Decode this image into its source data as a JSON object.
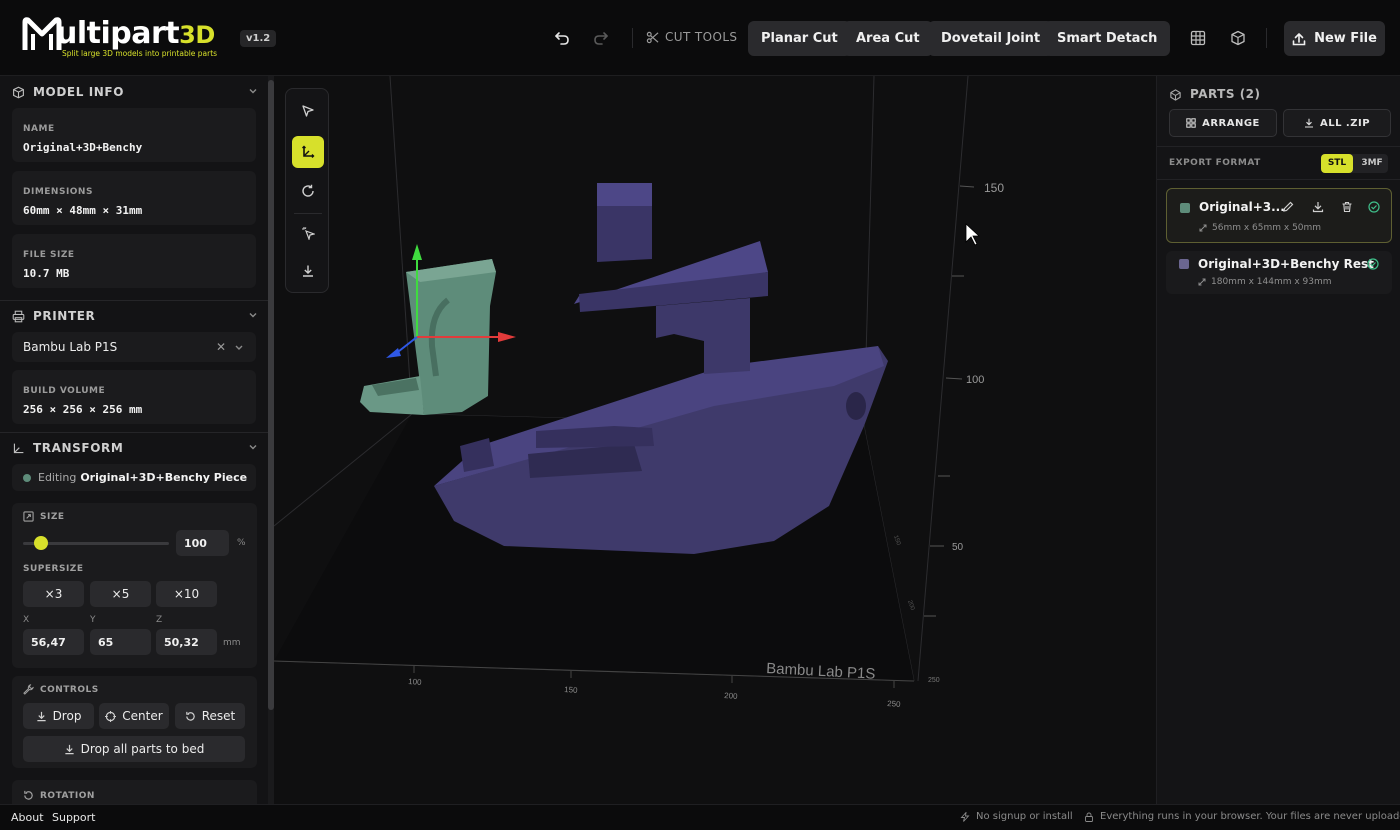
{
  "app": {
    "logo_main": "ultipart",
    "logo_accent": "3D",
    "tagline": "Split large 3D models into printable parts",
    "version": "v1.2"
  },
  "toolbar": {
    "cut_tools_label": "CUT TOOLS",
    "tools": [
      "Planar Cut",
      "Area Cut",
      "Dovetail Joint",
      "Smart Detach"
    ],
    "new_file_label": "New File"
  },
  "model_info": {
    "title": "MODEL INFO",
    "name_label": "NAME",
    "name_value": "Original+3D+Benchy",
    "dimensions_label": "DIMENSIONS",
    "dimensions_value": "60mm × 48mm × 31mm",
    "filesize_label": "FILE SIZE",
    "filesize_value": "10.7 MB"
  },
  "printer": {
    "title": "PRINTER",
    "selected": "Bambu Lab P1S",
    "build_volume_label": "BUILD VOLUME",
    "build_volume_value": "256 × 256 × 256 mm"
  },
  "transform": {
    "title": "TRANSFORM",
    "editing_prefix": "Editing",
    "editing_target": "Original+3D+Benchy Piece",
    "size_label": "SIZE",
    "size_value": "100",
    "size_unit": "%",
    "size_slider_fraction": 0.12,
    "supersize_label": "SUPERSIZE",
    "supersize_options": [
      "×3",
      "×5",
      "×10"
    ],
    "axis_x_label": "X",
    "axis_y_label": "Y",
    "axis_z_label": "Z",
    "x_value": "56,47",
    "y_value": "65",
    "z_value": "50,32",
    "dim_unit": "mm"
  },
  "controls": {
    "title": "CONTROLS",
    "drop_label": "Drop",
    "center_label": "Center",
    "reset_label": "Reset",
    "drop_all_label": "Drop all parts to bed"
  },
  "rotation": {
    "title": "ROTATION"
  },
  "viewport": {
    "printer_label": "Bambu Lab P1S",
    "z_ticks": [
      "150",
      "100",
      "50"
    ],
    "x_ticks": [
      "100",
      "150",
      "200",
      "250"
    ],
    "y_ticks": [
      "250",
      "200",
      "150"
    ],
    "piece_color": "#5e8c7a",
    "rest_color": "#3f3a6b"
  },
  "parts": {
    "title": "PARTS (2)",
    "arrange_label": "ARRANGE",
    "zip_label": "ALL .ZIP",
    "export_format_label": "EXPORT FORMAT",
    "format_stl": "STL",
    "format_3mf": "3MF",
    "items": [
      {
        "name": "Original+3...",
        "dims": "56mm x 65mm x 50mm",
        "color": "#5e8c7a"
      },
      {
        "name": "Original+3D+Benchy Rest",
        "dims": "180mm x 144mm x 93mm",
        "color": "#6b6690"
      }
    ]
  },
  "footer": {
    "about": "About",
    "support": "Support",
    "no_signup": "No signup or install",
    "privacy": "Everything runs in your browser. Your files are never uploaded."
  },
  "colors": {
    "accent": "#d7e02b",
    "success": "#3fbf8a"
  }
}
